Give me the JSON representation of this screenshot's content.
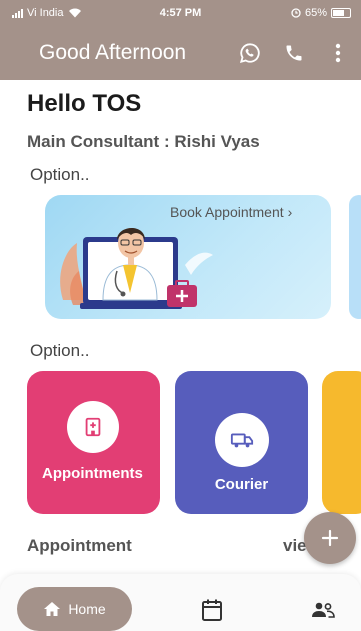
{
  "status_bar": {
    "carrier": "Vi India",
    "time": "4:57 PM",
    "battery": "65%",
    "icons": [
      "signal-icon",
      "wifi-icon",
      "alarm-icon",
      "battery-icon"
    ]
  },
  "app_bar": {
    "title": "Good Afternoon",
    "actions": [
      "whatsapp-icon",
      "phone-icon",
      "more-vert-icon"
    ]
  },
  "greeting": "Hello TOS",
  "consultant": "Main Consultant : Rishi Vyas",
  "options_1_title": "Option..",
  "banner": {
    "label": "Book Appointment",
    "chevron": "›",
    "icon": "doctor-illustration"
  },
  "options_2_title": "Option..",
  "cards": [
    {
      "label": "Appointments",
      "icon": "hospital-icon",
      "color": "#e23e74"
    },
    {
      "label": "Courier",
      "icon": "truck-icon",
      "color": "#575dbc"
    },
    {
      "label": "",
      "icon": "",
      "color": "#f6b92d"
    }
  ],
  "appointment_section": {
    "title": "Appointment",
    "view_label": "vie"
  },
  "fab": {
    "icon": "plus-icon"
  },
  "bottom_nav": {
    "home_label": "Home",
    "items": [
      "home-icon",
      "calendar-icon",
      "people-icon"
    ]
  },
  "colors": {
    "primary": "#a4928a",
    "pink": "#e23e74",
    "blue": "#575dbc",
    "yellow": "#f6b92d"
  }
}
